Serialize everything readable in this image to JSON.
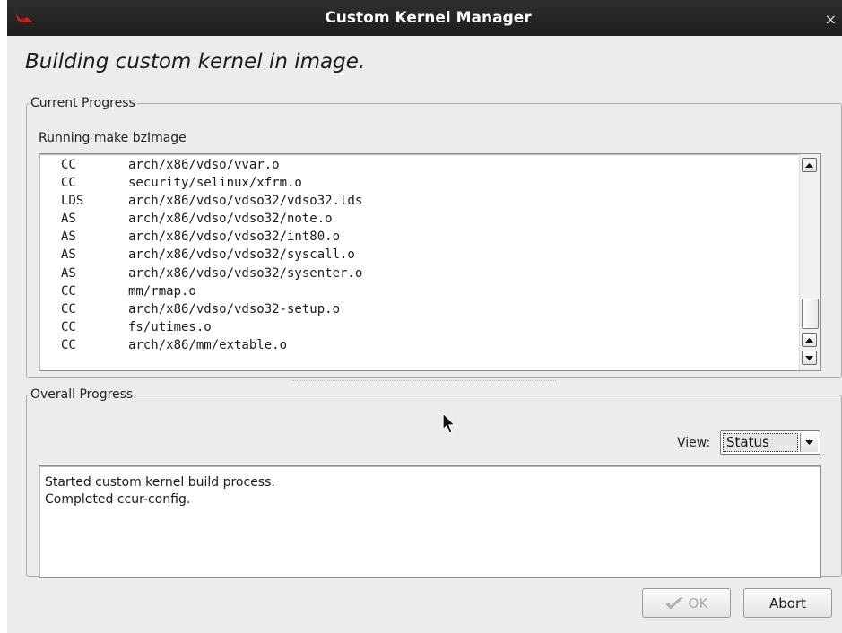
{
  "window": {
    "title": "Custom Kernel Manager",
    "app_icon": "redhawk-icon",
    "close_glyph": "×"
  },
  "heading": "Building custom kernel in image.",
  "current_progress": {
    "legend": "Current Progress",
    "task": "Running make bzImage",
    "log": [
      {
        "cmd": "CC",
        "path": "arch/x86/vdso/vvar.o"
      },
      {
        "cmd": "CC",
        "path": "security/selinux/xfrm.o"
      },
      {
        "cmd": "LDS",
        "path": "arch/x86/vdso/vdso32/vdso32.lds"
      },
      {
        "cmd": "AS",
        "path": "arch/x86/vdso/vdso32/note.o"
      },
      {
        "cmd": "AS",
        "path": "arch/x86/vdso/vdso32/int80.o"
      },
      {
        "cmd": "AS",
        "path": "arch/x86/vdso/vdso32/syscall.o"
      },
      {
        "cmd": "AS",
        "path": "arch/x86/vdso/vdso32/sysenter.o"
      },
      {
        "cmd": "CC",
        "path": "mm/rmap.o"
      },
      {
        "cmd": "CC",
        "path": "arch/x86/vdso/vdso32-setup.o"
      },
      {
        "cmd": "CC",
        "path": "fs/utimes.o"
      },
      {
        "cmd": "CC",
        "path": "arch/x86/mm/extable.o"
      }
    ]
  },
  "overall_progress": {
    "legend": "Overall Progress",
    "view_label": "View:",
    "view_value": "Status",
    "status_lines": [
      "Started custom kernel build process.",
      "Completed ccur-config."
    ]
  },
  "buttons": {
    "ok_label": "OK",
    "ok_enabled": false,
    "abort_label": "Abort"
  },
  "colors": {
    "titlebar": "#1d1d1d",
    "window_bg": "#edeceb",
    "disabled_text": "#a8a8a8"
  }
}
